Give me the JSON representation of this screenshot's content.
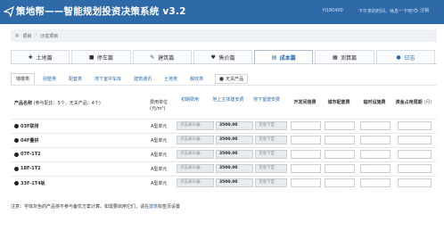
{
  "header": {
    "title": "策地帮——智能规划投资决策系统 v3.2",
    "user": "H180400",
    "greeting": "下午茶的时间，休息一下吧!",
    "logout": "注销"
  },
  "breadcrumb": {
    "root": "项目",
    "current": "沙龙项目"
  },
  "main_tabs": [
    {
      "label": "土地篇",
      "icon": "land-icon"
    },
    {
      "label": "停车篇",
      "icon": "car-icon"
    },
    {
      "label": "建筑篇",
      "icon": "building-icon"
    },
    {
      "label": "售价篇",
      "icon": "price-icon"
    },
    {
      "label": "成本篇",
      "icon": "cost-icon",
      "active": true
    },
    {
      "label": "测算篇",
      "icon": "calc-icon"
    },
    {
      "label": "日志",
      "icon": "log-icon"
    }
  ],
  "sub_tabs": [
    {
      "label": "墙楼类",
      "active": true
    },
    {
      "label": "别墅类"
    },
    {
      "label": "配套类"
    },
    {
      "label": "地下室中车库"
    },
    {
      "label": "建筑通讯"
    },
    {
      "label": "土地类"
    },
    {
      "label": "税收类"
    }
  ],
  "sub_check_label": "无关产品",
  "table": {
    "headers": {
      "product": "产品名称",
      "product_note": "(参与配比：5个，无关产品：4个)",
      "type": "费用单位",
      "type_unit": "(元/m²)",
      "col1": "初期费用",
      "col2": "地上主体建安费",
      "col3": "地下室建安费",
      "col4": "开发间接费",
      "col5": "城市配套费",
      "col6": "临时设施费",
      "col7": "资金占用周期",
      "col7_unit": "(月)"
    },
    "rows": [
      {
        "name": "03F联排",
        "type": "A型单元",
        "c1": "点击录头编",
        "c2": "3500.00",
        "c3": "无地下室"
      },
      {
        "name": "04F叠拼",
        "type": "A型单元",
        "c1": "点击录头编",
        "c2": "3500.00",
        "c3": "无地下室"
      },
      {
        "name": "07F-1T2",
        "type": "A型单元",
        "c1": "点击录头编",
        "c2": "3500.00",
        "c3": "无地下室"
      },
      {
        "name": "18F-1T2",
        "type": "A型单元",
        "c1": "点击录头编",
        "c2": "3500.00",
        "c3": "无地下室"
      },
      {
        "name": "33F-1T4板",
        "type": "A型单元",
        "c1": "点击录头编",
        "c2": "3500.00",
        "c3": "无地下室"
      }
    ]
  },
  "note": {
    "text": "注意：字体灰色的产品将不参与备忧方案计算。如需要启用它们，请在",
    "link": "建筑",
    "tail": "标签页设置"
  }
}
